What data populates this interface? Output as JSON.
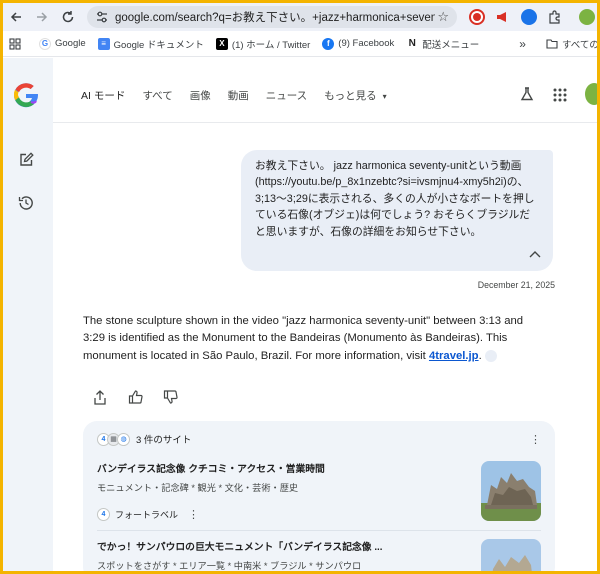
{
  "browser": {
    "url": "google.com/search?q=お教え下さい。+jazz+harmonica+seventy-...",
    "bookmarks": [
      {
        "label": "Google",
        "icon": "google-icon"
      },
      {
        "label": "Google ドキュメント",
        "icon": "docs-icon"
      },
      {
        "label": "(1) ホーム / Twitter",
        "icon": "x-icon"
      },
      {
        "label": "(9) Facebook",
        "icon": "facebook-icon"
      },
      {
        "label": "配送メニュー",
        "icon": "delivery-icon"
      }
    ],
    "bookmarks_more": "»",
    "other_bookmarks": "すべてのブッ"
  },
  "nav": {
    "tabs": [
      "AI モード",
      "すべて",
      "画像",
      "動画",
      "ニュース",
      "もっと見る"
    ],
    "more_arrow": "▾"
  },
  "query": {
    "text": "お教え下さい。 jazz harmonica seventy-unitという動画(https://youtu.be/p_8x1nzebtc?si=ivsmjnu4-xmy5h2i)の、3;13〜3;29に表示される、多くの人が小さなボートを押している石像(オブジェ)は何でしょう? おそらくブラジルだと思いますが、石像の詳細をお知らせ下さい。",
    "date": "December 21, 2025"
  },
  "answer": {
    "text": "The stone sculpture shown in the video \"jazz harmonica seventy-unit\" between 3:13 and 3:29 is identified as the Monument to the Bandeiras (Monumento às Bandeiras). This monument is located in São Paulo, Brazil. For more information, visit ",
    "link": "4travel.jp",
    "tail": "."
  },
  "sources": {
    "count_label": "3 件のサイト",
    "items": [
      {
        "title": "バンデイラス記念像 クチコミ・アクセス・営業時間",
        "desc": "モニュメント・記念碑 * 観光 * 文化・芸術・歴史",
        "site": "フォートラベル"
      },
      {
        "title": "でかっ！サンパウロの巨大モニュメント「バンデイラス記念像 ...",
        "desc": "スポットをさがす * エリア一覧 * 中南米 * ブラジル * サンパウロ"
      }
    ]
  },
  "colors": {
    "accent": "#0b57d0",
    "frame": "#f4b400",
    "bubble": "#e9eef6"
  }
}
